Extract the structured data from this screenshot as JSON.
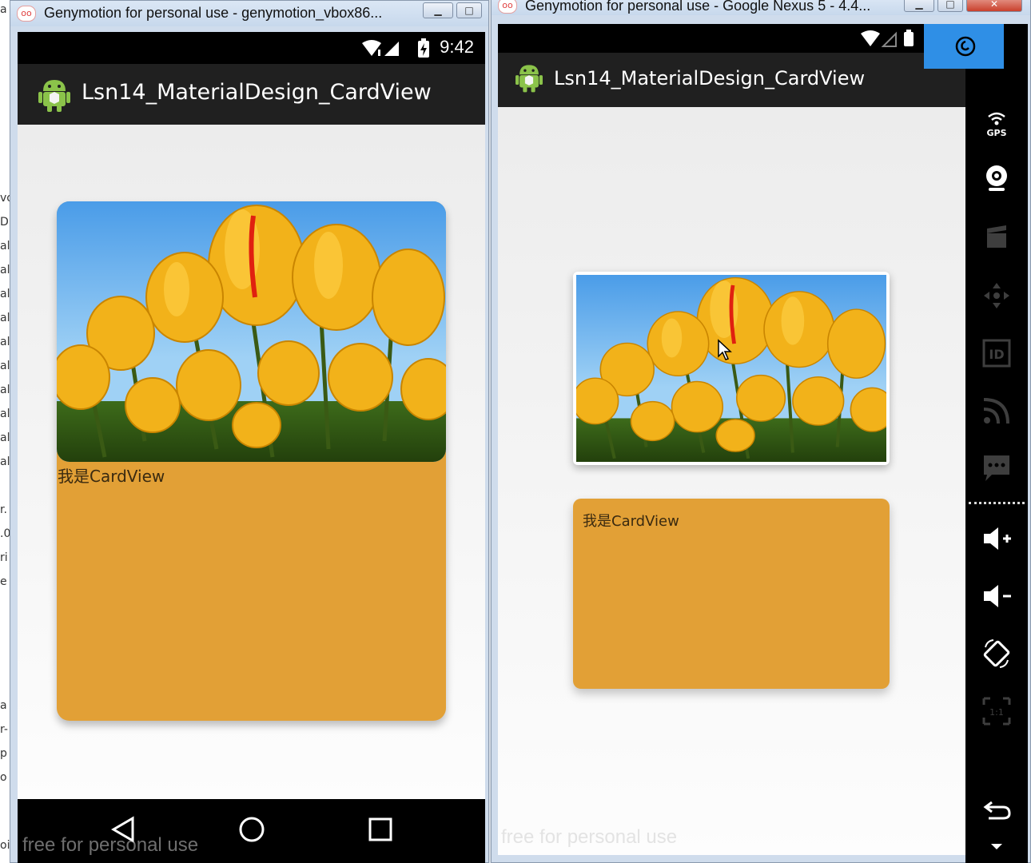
{
  "left_window": {
    "title": "Genymotion for personal use - genymotion_vbox86...",
    "status_time": "9:42",
    "app_title": "Lsn14_MaterialDesign_CardView",
    "card_text": "我是CardView",
    "watermark": "free for personal use"
  },
  "right_window": {
    "title": "Genymotion for personal use - Google Nexus 5 - 4.4...",
    "app_title": "Lsn14_MaterialDesign_CardView",
    "card_text": "我是CardView",
    "watermark": "free for personal use"
  },
  "sidebar": {
    "gps_label": "GPS",
    "id_label": "ID",
    "ratio_label": "1:1",
    "items": [
      "gps-icon",
      "webcam-icon",
      "video-capture-icon",
      "dpad-icon",
      "device-id-icon",
      "network-icon",
      "sms-icon",
      "volume-up-icon",
      "volume-down-icon",
      "rotate-icon",
      "pixel-perfect-icon",
      "back-icon",
      "menu-icon"
    ]
  },
  "colors": {
    "card_orange": "#e2a036",
    "actionbar": "#202020",
    "screen_bg": "#f0f0f0",
    "genymotion_blue": "#2f8fe6"
  }
}
